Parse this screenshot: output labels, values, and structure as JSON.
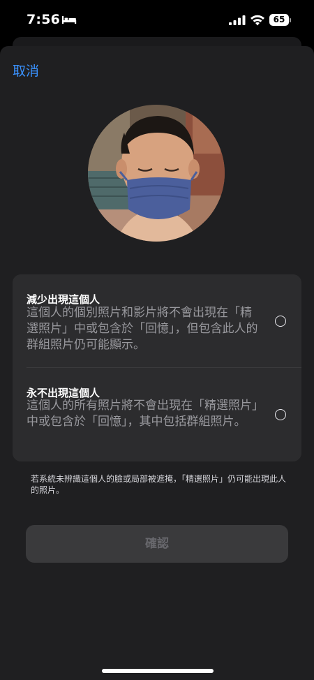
{
  "status_bar": {
    "time": "7:56",
    "battery_percent": "65",
    "icons": [
      "bed-icon",
      "signal-icon",
      "wifi-icon",
      "battery-icon"
    ]
  },
  "nav": {
    "cancel_label": "取消"
  },
  "avatar": {
    "icon": "person-photo"
  },
  "options": [
    {
      "title": "減少出現這個人",
      "description": "這個人的個別照片和影片將不會出現在「精選照片」中或包含於「回憶」，但包含此人的群組照片仍可能顯示。",
      "selected": false
    },
    {
      "title": "永不出現這個人",
      "description": "這個人的所有照片將不會出現在「精選照片」中或包含於「回憶」，其中包括群組照片。",
      "selected": false
    }
  ],
  "footnote": "若系統未辨識這個人的臉或局部被遮掩，「精選照片」仍可能出現此人的照片。",
  "confirm_button": {
    "label": "確認",
    "enabled": false
  },
  "colors": {
    "accent": "#3a92ff",
    "sheet_background": "#1f1f21",
    "card_background": "#2c2c2e",
    "secondary_text": "#98989d"
  }
}
